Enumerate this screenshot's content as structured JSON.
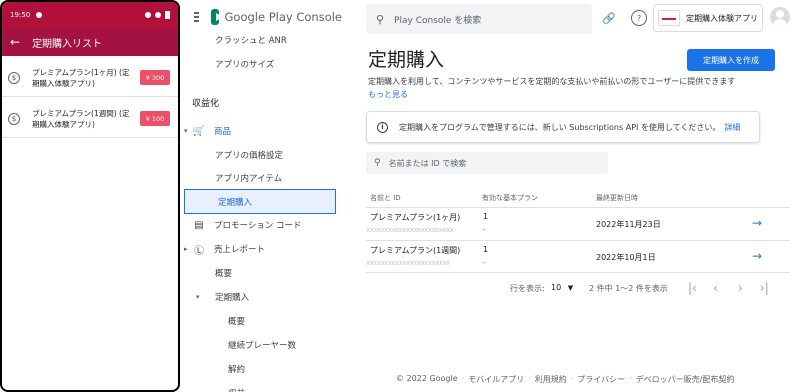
{
  "phone": {
    "status_time": "19:50",
    "appbar_title": "定期購入リスト",
    "items": [
      {
        "title": "プレミアムプラン(1ヶ月) (定期購入体験アプリ)",
        "price": "¥ 300"
      },
      {
        "title": "プレミアムプラン(1週間) (定期購入体験アプリ)",
        "price": "¥ 100"
      }
    ]
  },
  "console": {
    "brand": "Google Play Console",
    "search_placeholder": "Play Console を検索",
    "account_name": "定期購入体験アプリ",
    "nav": {
      "crashes": "クラッシュと ANR",
      "app_size": "アプリのサイズ",
      "monetize": "収益化",
      "products": "商品",
      "app_pricing": "アプリの価格設定",
      "in_app": "アプリ内アイテム",
      "subscriptions": "定期購入",
      "promo_codes": "プロモーション コード",
      "financial_reports": "売上レポート",
      "overview": "概要",
      "fr_subscriptions": "定期購入",
      "fr_sub_overview": "概要",
      "retained_players": "継続プレーヤー数",
      "cancellations": "解約",
      "revenue": "収益"
    },
    "page": {
      "title": "定期購入",
      "create_button": "定期購入を作成",
      "description": "定期購入を利用して、コンテンツやサービスを定期的な支払いや前払いの形でユーザーに提供できます",
      "learn_more": "もっと見る",
      "info_text": "定期購入をプログラムで管理するには、新しい Subscriptions API を使用してください。",
      "info_link": "詳細",
      "filter_placeholder": "名前または ID で検索",
      "columns": [
        "名前と ID",
        "有効な基本プラン",
        "最終更新日時"
      ],
      "rows": [
        {
          "name": "プレミアムプラン(1ヶ月)",
          "id": "xxxxxxxxxxxxxxxxxxxxxxxx",
          "plans": "1",
          "plans_sub": "-",
          "updated": "2022年11月23日"
        },
        {
          "name": "プレミアムプラン(1週間)",
          "id": "xxxxxxxxxxxxxxxxxxxxxxx",
          "plans": "1",
          "plans_sub": "-",
          "updated": "2022年10月1日"
        }
      ],
      "rows_label": "行を表示:",
      "rows_value": "10",
      "range_text": "2 件中 1〜2 件を表示"
    },
    "footer": [
      "© 2022 Google",
      "モバイルアプリ",
      "利用規約",
      "プライバシー",
      "デベロッパー販売/配布契約"
    ]
  }
}
